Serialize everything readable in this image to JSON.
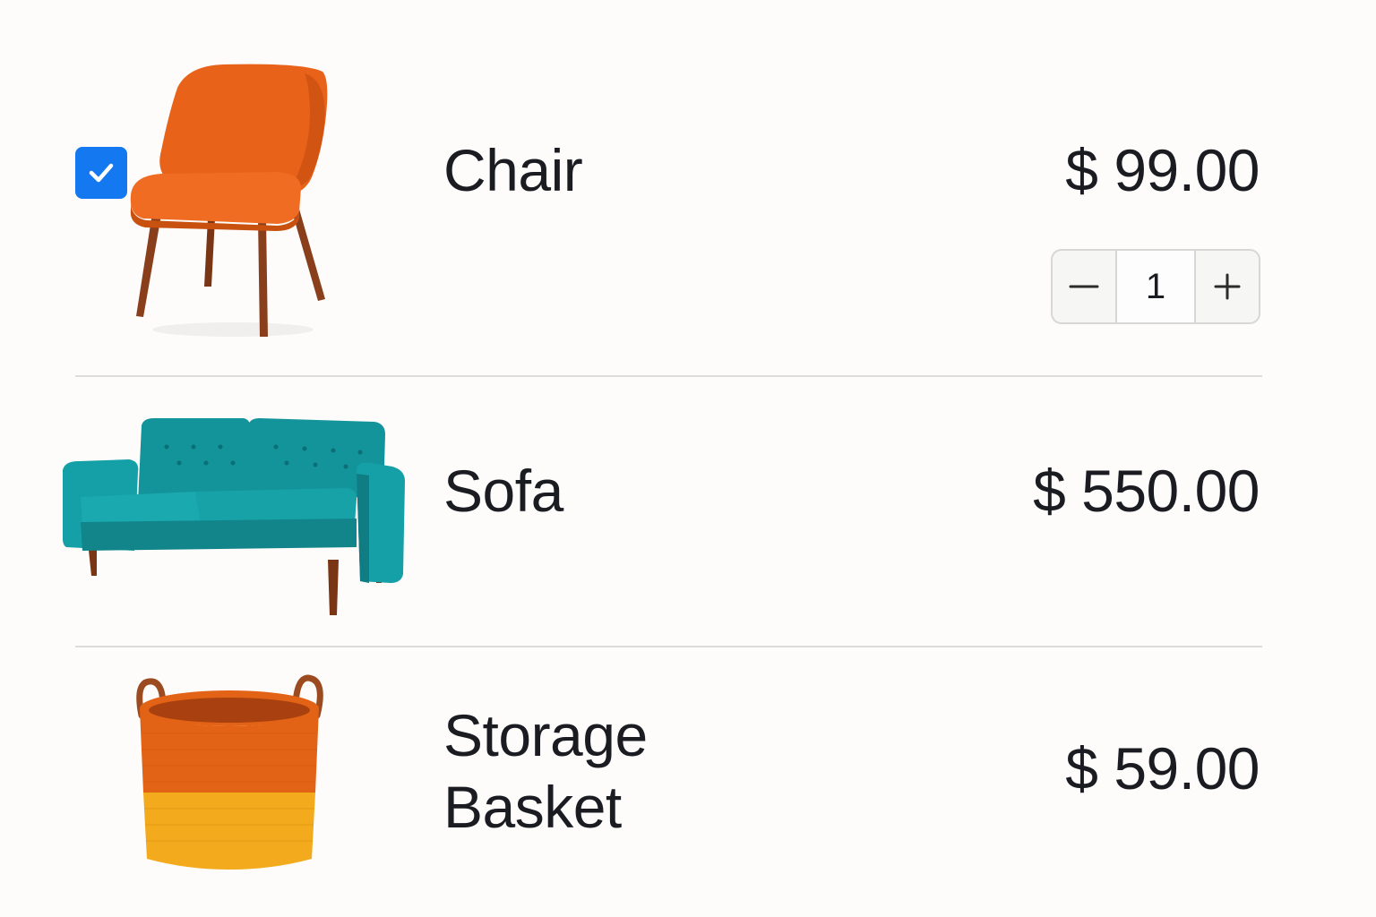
{
  "items": [
    {
      "name": "Chair",
      "price": "$ 99.00",
      "selected": true,
      "quantity": "1",
      "image_icon": "orange-chair-icon"
    },
    {
      "name": "Sofa",
      "price": "$ 550.00",
      "image_icon": "teal-sofa-icon"
    },
    {
      "name": "Storage\nBasket",
      "price": "$ 59.00",
      "image_icon": "orange-yellow-basket-icon"
    }
  ],
  "colors": {
    "checkbox": "#1478f0",
    "chair": "#e8621a",
    "sofa": "#13939a",
    "basket_top": "#e26316",
    "basket_bottom": "#f3aa1c",
    "wood": "#8a3f1c"
  }
}
